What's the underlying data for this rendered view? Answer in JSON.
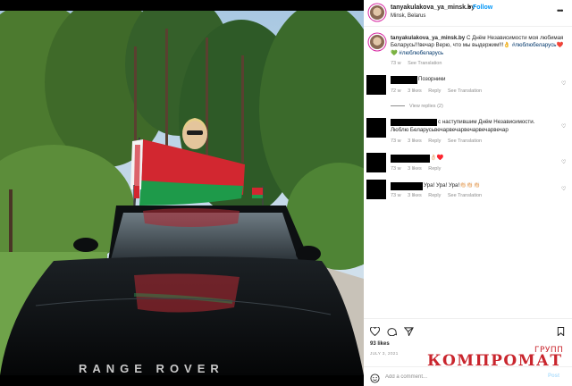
{
  "header": {
    "username": "tanyakulakova_ya_minsk.by",
    "separator": "•",
    "follow_label": "Follow",
    "location": "Minsk, Belarus"
  },
  "caption": {
    "username": "tanyakulakova_ya_minsk.by",
    "text": "С Днём Независимости моя любимая Беларусь!!!вечар Верю, что мы выдержим!!!👌",
    "hashtags": "#люблюбеларусь❤️💚 #люблюбеларусь",
    "time": "73 w",
    "see_translation": "See Translation"
  },
  "comments": [
    {
      "text": "Позорники",
      "time": "72 w",
      "likes": "3 likes",
      "reply": "Reply",
      "see_translation": "See Translation"
    },
    {
      "text_line1": "с наступившим Днём Независимости.",
      "text_line2": "Люблю Беларусьвечарвечарвечарвечарвечар",
      "time": "73 w",
      "likes": "3 likes",
      "reply": "Reply",
      "see_translation": "See Translation"
    },
    {
      "text": "👌🏻♥️",
      "time": "73 w",
      "likes": "3 likes",
      "reply": "Reply"
    },
    {
      "text": "Ура! Ура! Ура!👏🏻👏🏻👏🏻",
      "time": "73 w",
      "likes": "3 likes",
      "reply": "Reply",
      "see_translation": "See Translation"
    }
  ],
  "view_replies": "View replies (2)",
  "actions": {
    "likes": "93 likes",
    "date": "JULY 3, 2021"
  },
  "add_comment": {
    "placeholder": "Add a comment...",
    "post_label": "Post"
  },
  "watermark": {
    "small": "ГРУПП",
    "big": "КОМПРОМАТ"
  },
  "photo": {
    "license_plate_text": "RANGE ROVER"
  },
  "colors": {
    "link_blue": "#0095f6",
    "text": "#262626",
    "muted": "#8e8e8e",
    "watermark_red": "#c9252d",
    "flag_red": "#d22730",
    "flag_green": "#00af66"
  }
}
